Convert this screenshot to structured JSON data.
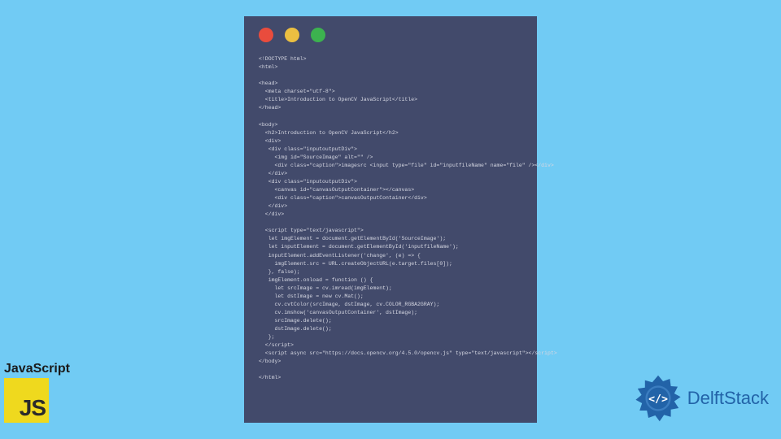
{
  "code_window": {
    "traffic_lights": {
      "red": "#e94c3d",
      "yellow": "#ebbf41",
      "green": "#3cb24f"
    },
    "code": "<!DOCTYPE html>\n<html>\n\n<head>\n  <meta charset=\"utf-8\">\n  <title>Introduction to OpenCV JavaScript</title>\n</head>\n\n<body>\n  <h2>Introduction to OpenCV JavaScript</h2>\n  <div>\n   <div class=\"inputoutputDiv\">\n     <img id=\"SourceImage\" alt=\"\" />\n     <div class=\"caption\">imagesrc <input type=\"file\" id=\"inputfileName\" name=\"file\" /></div>\n   </div>\n   <div class=\"inputoutputDiv\">\n     <canvas id=\"canvasOutputContainer\"></canvas>\n     <div class=\"caption\">canvasOutputContainer</div>\n   </div>\n  </div>\n\n  <script type=\"text/javascript\">\n   let imgElement = document.getElementById('SourceImage');\n   let inputElement = document.getElementById('inputfileName');\n   inputElement.addEventListener('change', (e) => {\n     imgElement.src = URL.createObjectURL(e.target.files[0]);\n   }, false);\n   imgElement.onload = function () {\n     let srcImage = cv.imread(imgElement);\n     let dstImage = new cv.Mat();\n     cv.cvtColor(srcImage, dstImage, cv.COLOR_RGBA2GRAY);\n     cv.imshow('canvasOutputContainer', dstImage);\n     srcImage.delete();\n     dstImage.delete();\n   };\n  </script>\n  <script async src=\"https://docs.opencv.org/4.5.0/opencv.js\" type=\"text/javascript\"></script>\n</body>\n\n</html>"
  },
  "js_badge": {
    "label": "JavaScript",
    "logo_text": "JS"
  },
  "delft": {
    "text": "DelftStack"
  }
}
